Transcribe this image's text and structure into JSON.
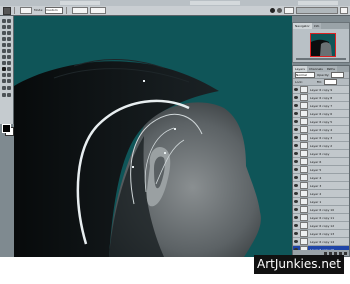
{
  "options_bar": {
    "mode_label": "Mode:",
    "mode_value": "Custom",
    "icons": [
      "selection-tool-icon",
      "brush-preset-icon",
      "airbrush-icon",
      "palette-icon"
    ]
  },
  "toolbox": {
    "foreground_color": "#000000",
    "background_color": "#ffffff"
  },
  "navigator_panel": {
    "tabs": [
      "Navigator",
      "Info"
    ]
  },
  "layers_panel": {
    "tabs": [
      "Layers",
      "Channels",
      "Paths"
    ],
    "blend_mode": "Normal",
    "opacity_label": "Opacity:",
    "fill_label": "Fill:",
    "lock_label": "Lock:",
    "layers": [
      "Layer 6 copy 9",
      "Layer 6 copy 8",
      "Layer 6 copy 7",
      "Layer 6 copy 6",
      "Layer 6 copy 5",
      "Layer 6 copy 4",
      "Layer 6 copy 3",
      "Layer 6 copy 2",
      "Layer 6 copy",
      "Layer 6",
      "Layer 5",
      "Layer 4",
      "Layer 3",
      "Layer 2",
      "Layer 1",
      "Layer 6 copy 10",
      "Layer 6 copy 11",
      "Layer 6 copy 12",
      "Layer 6 copy 13",
      "Layer 6 copy 14",
      "Layer 6 copy 15"
    ],
    "active_layer": "Layer 6 copy 15"
  },
  "canvas": {
    "background_color": "#0f5558"
  },
  "watermark": "ArtJunkies.net"
}
